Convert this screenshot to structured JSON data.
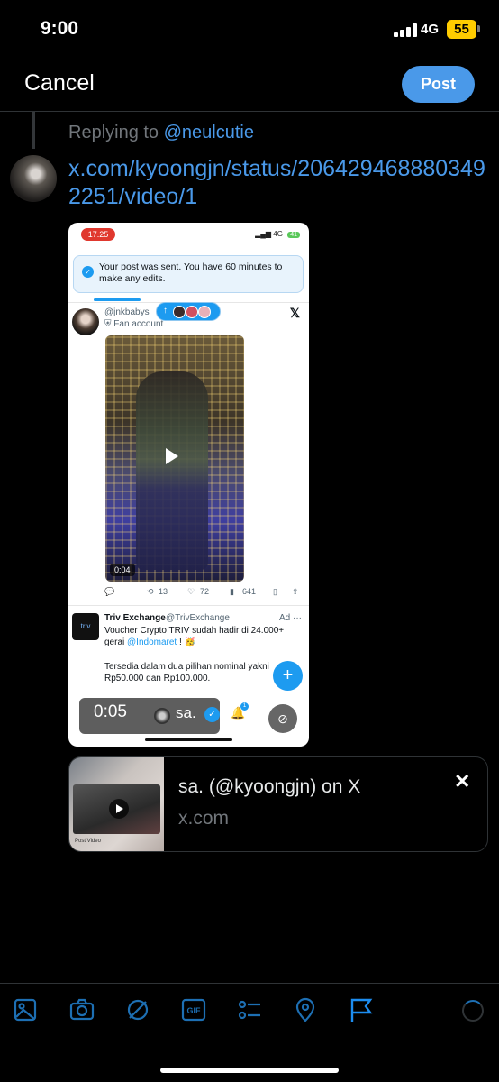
{
  "status_bar": {
    "time": "9:00",
    "network": "4G",
    "battery": "55"
  },
  "header": {
    "cancel_label": "Cancel",
    "post_label": "Post"
  },
  "reply": {
    "prefix": "Replying to",
    "handle": "@neulcutie"
  },
  "compose": {
    "text": "x.com/kyoongjn/status/2064294688803492251/video/1"
  },
  "screenshot": {
    "status_time": "17.25",
    "status_network": "4G",
    "status_battery": "41",
    "toast": "Your post was sent. You have 60 minutes to make any edits.",
    "post_handle": "@jnkbabys",
    "post_badge": "Fan account",
    "video_time": "0:04",
    "actions": {
      "retweets": "13",
      "likes": "72",
      "views": "641"
    },
    "ad": {
      "name": "Triv Exchange",
      "handle": "@TrivExchange",
      "tag": "Ad",
      "logo": "triv",
      "body_line1": "Voucher Crypto TRIV sudah hadir di 24.000+ gerai",
      "mention": "@Indomaret",
      "body_line1_end": "!",
      "body_line2": "Tersedia dalam dua pilihan nominal yakni",
      "body_line3": "Rp50.000 dan Rp100.000."
    },
    "overlay": {
      "time": "0:05",
      "name": "sa."
    },
    "bell_badge": "1"
  },
  "link_card": {
    "title": "sa. (@kyoongjn) on X",
    "domain": "x.com",
    "thumb_label": "Post Video"
  },
  "toolbar": {
    "icons": [
      "image-icon",
      "camera-icon",
      "grok-icon",
      "gif-icon",
      "poll-icon",
      "location-icon",
      "flag-icon"
    ],
    "accent": "#1d6fb3"
  },
  "colors": {
    "accent": "#4a99e9",
    "background": "#000000",
    "muted": "#71767b"
  }
}
